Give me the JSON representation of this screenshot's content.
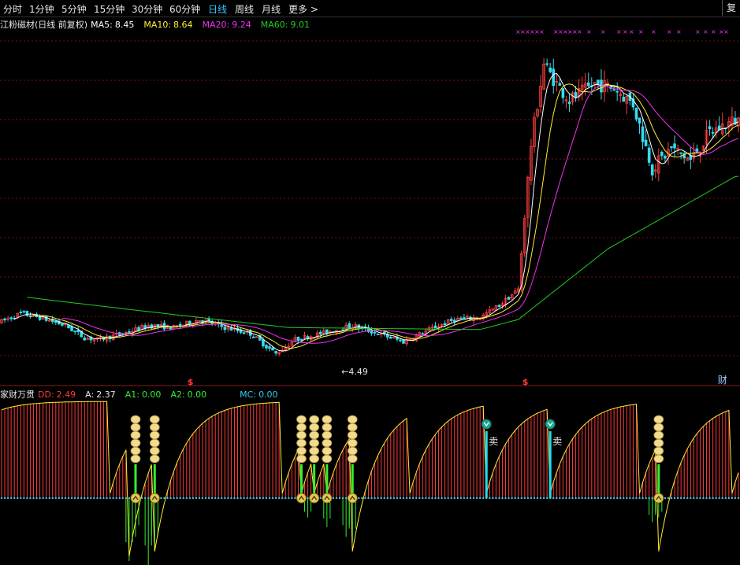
{
  "toolbar": {
    "tabs": [
      {
        "label": "分时",
        "active": false
      },
      {
        "label": "1分钟",
        "active": false
      },
      {
        "label": "5分钟",
        "active": false
      },
      {
        "label": "15分钟",
        "active": false
      },
      {
        "label": "30分钟",
        "active": false
      },
      {
        "label": "60分钟",
        "active": false
      },
      {
        "label": "日线",
        "active": true
      },
      {
        "label": "周线",
        "active": false
      },
      {
        "label": "月线",
        "active": false
      },
      {
        "label": "更多 >",
        "active": false
      }
    ],
    "right_button": "复"
  },
  "colors": {
    "background": "#000000",
    "grid": "#7a1010",
    "up": "#ff4040",
    "down": "#33ddee",
    "ma5": "#ffffff",
    "ma10": "#ffee33",
    "ma20": "#ee33ee",
    "ma60": "#22cc22",
    "dd": "#ff3a3a",
    "a": "#e8e8e8",
    "a1": "#33ee33",
    "a2": "#33ee33",
    "mc": "#33ccee",
    "sell": "#22ddee",
    "coin": "#f0dc8c"
  },
  "main_legend": {
    "title": "江粉磁材(日线 前复权)",
    "ma5_label": "MA5:",
    "ma5_value": "8.45",
    "ma10_label": "MA10:",
    "ma10_value": "8.64",
    "ma20_label": "MA20:",
    "ma20_value": "9.24",
    "ma60_label": "MA60:",
    "ma60_value": "9.01"
  },
  "sub_legend": {
    "title": "家财万贯",
    "dd_label": "DD:",
    "dd_value": "2.49",
    "a_label": "A:",
    "a_value": "2.37",
    "a1_label": "A1:",
    "a1_value": "0.00",
    "a2_label": "A2:",
    "a2_value": "0.00",
    "mc_label": "MC:",
    "mc_value": "0.00"
  },
  "annotations": {
    "low_price": "4.49",
    "sell_label": "卖",
    "finance_label": "财",
    "dollar_marker": "$"
  },
  "chart_data": {
    "type": "candlestick",
    "panels": [
      "price",
      "indicator"
    ],
    "ma_periods": [
      5,
      10,
      20,
      60
    ],
    "price_series_name": "江粉磁材",
    "period": "日线",
    "adjustment": "前复权",
    "price_visible_low": 4.49,
    "last_ma": {
      "MA5": 8.45,
      "MA10": 8.64,
      "MA20": 9.24,
      "MA60": 9.01
    },
    "indicator_last": {
      "DD": 2.49,
      "A": 2.37,
      "A1": 0.0,
      "A2": 0.0,
      "MC": 0.0
    },
    "price_shape": [
      [
        0,
        5.4
      ],
      [
        6,
        5.6
      ],
      [
        12,
        5.5
      ],
      [
        20,
        5.3
      ],
      [
        26,
        5.0
      ],
      [
        30,
        4.95
      ],
      [
        38,
        5.1
      ],
      [
        46,
        5.3
      ],
      [
        54,
        5.25
      ],
      [
        62,
        5.45
      ],
      [
        70,
        5.25
      ],
      [
        78,
        5.1
      ],
      [
        86,
        4.6
      ],
      [
        92,
        4.95
      ],
      [
        100,
        5.1
      ],
      [
        110,
        5.3
      ],
      [
        118,
        5.1
      ],
      [
        126,
        4.9
      ],
      [
        134,
        5.2
      ],
      [
        142,
        5.45
      ],
      [
        150,
        5.5
      ],
      [
        156,
        5.8
      ],
      [
        162,
        6.2
      ],
      [
        166,
        9.8
      ],
      [
        170,
        11.8
      ],
      [
        174,
        11.3
      ],
      [
        178,
        10.9
      ],
      [
        186,
        11.3
      ],
      [
        192,
        11.2
      ],
      [
        198,
        10.8
      ],
      [
        204,
        9.2
      ],
      [
        210,
        9.7
      ],
      [
        216,
        9.4
      ],
      [
        222,
        10.1
      ],
      [
        230,
        10.4
      ]
    ],
    "ma60_shape": [
      [
        8,
        6.0
      ],
      [
        40,
        5.7
      ],
      [
        90,
        5.25
      ],
      [
        150,
        5.2
      ],
      [
        162,
        5.45
      ],
      [
        190,
        7.2
      ],
      [
        230,
        9.0
      ]
    ],
    "buy_signal_bars": [
      42,
      48,
      94,
      98,
      102,
      110,
      206
    ],
    "sell_signal_bars": [
      152,
      172
    ],
    "finance_marker_bar": 226,
    "dollar_marker_bars": [
      59,
      164
    ]
  }
}
